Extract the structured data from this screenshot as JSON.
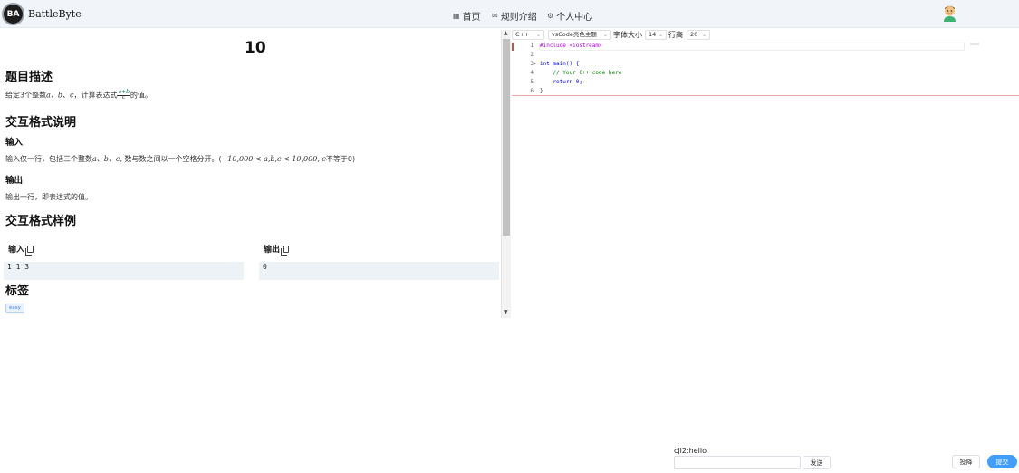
{
  "header": {
    "brand": "BattleByte",
    "logo_text": "BA",
    "nav": [
      {
        "icon": "grid-icon",
        "label": "首页"
      },
      {
        "icon": "mail-icon",
        "label": "规则介绍"
      },
      {
        "icon": "gear-icon",
        "label": "个人中心"
      }
    ]
  },
  "problem": {
    "title": "10",
    "desc_heading": "题目描述",
    "desc_prefix": "给定3个整数",
    "desc_vars": "a、b、c",
    "desc_mid": "，计算表达式",
    "desc_frac_num": "a+b",
    "desc_frac_den": "c",
    "desc_suffix": "的值。",
    "io_heading": "交互格式说明",
    "input_heading": "输入",
    "input_text": "输入仅一行，包括三个整数",
    "input_vars": "a、b、c,",
    "input_text2": " 数与数之间以一个空格分开。(",
    "input_math": "−10,000 < a,b,c < 10,000, c",
    "input_text3": "不等于0)",
    "output_heading": "输出",
    "output_text": "输出一行，即表达式的值。",
    "sample_heading": "交互格式样例",
    "sample_input_label": "输入",
    "sample_output_label": "输出",
    "sample_input": "1 1 3",
    "sample_output": "0",
    "tags_heading": "标签",
    "tag": "easy"
  },
  "editor": {
    "language": "C++",
    "theme": "vsCode亮色主题",
    "font_size_label": "字体大小",
    "font_size": "14",
    "line_height_label": "行高",
    "line_height": "20",
    "code": [
      {
        "n": "1",
        "text": "#include <iostream>"
      },
      {
        "n": "2",
        "text": ""
      },
      {
        "n": "3",
        "text": "int main() {"
      },
      {
        "n": "4",
        "text": "    // Your C++ code here"
      },
      {
        "n": "5",
        "text": "    return 0;"
      },
      {
        "n": "6",
        "text": "}"
      }
    ]
  },
  "chat": {
    "message": "cjl2:hello",
    "input_value": "",
    "send_label": "发送",
    "surrender_label": "投降",
    "submit_label": "提交"
  }
}
